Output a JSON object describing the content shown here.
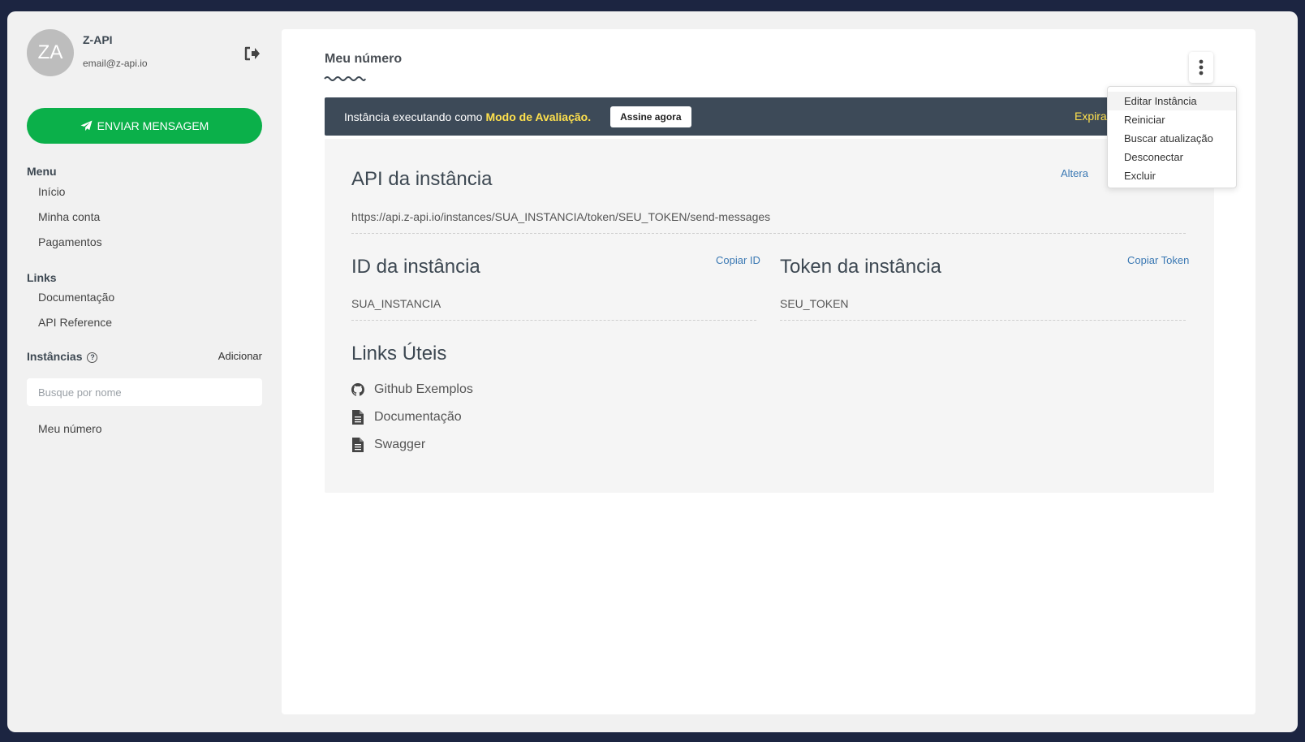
{
  "profile": {
    "initials": "ZA",
    "name": "Z-API",
    "email": "email@z-api.io"
  },
  "sidebar": {
    "send_button_label": "ENVIAR MENSAGEM",
    "menu_title": "Menu",
    "menu_items": [
      "Início",
      "Minha conta",
      "Pagamentos"
    ],
    "links_title": "Links",
    "links_items": [
      "Documentação",
      "API Reference"
    ],
    "instances_title": "Instâncias",
    "instances_add": "Adicionar",
    "search_placeholder": "Busque por nome",
    "instances": [
      "Meu número"
    ]
  },
  "main": {
    "title": "Meu número",
    "banner": {
      "text": "Instância executando como",
      "highlight": "Modo de Avaliação.",
      "button": "Assine agora",
      "expira": "Expira"
    },
    "api": {
      "title": "API da instância",
      "alter_link": "Altera",
      "url": "https://api.z-api.io/instances/SUA_INSTANCIA/token/SEU_TOKEN/send-messages"
    },
    "id": {
      "title": "ID da instância",
      "copy": "Copiar ID",
      "value": "SUA_INSTANCIA"
    },
    "token": {
      "title": "Token da instância",
      "copy": "Copiar Token",
      "value": "SEU_TOKEN"
    },
    "links_uteis": {
      "title": "Links Úteis",
      "items": [
        {
          "label": "Github Exemplos",
          "icon": "github-icon"
        },
        {
          "label": "Documentação",
          "icon": "document-icon"
        },
        {
          "label": "Swagger",
          "icon": "document-icon"
        }
      ]
    }
  },
  "dropdown": {
    "items": [
      "Editar Instância",
      "Reiniciar",
      "Buscar atualização",
      "Desconectar",
      "Excluir"
    ]
  },
  "colors": {
    "background": "#1c2541",
    "send_button": "#0bb04a",
    "banner": "#3d4a58",
    "highlight": "#ffe14d",
    "link": "#3a78b3"
  }
}
